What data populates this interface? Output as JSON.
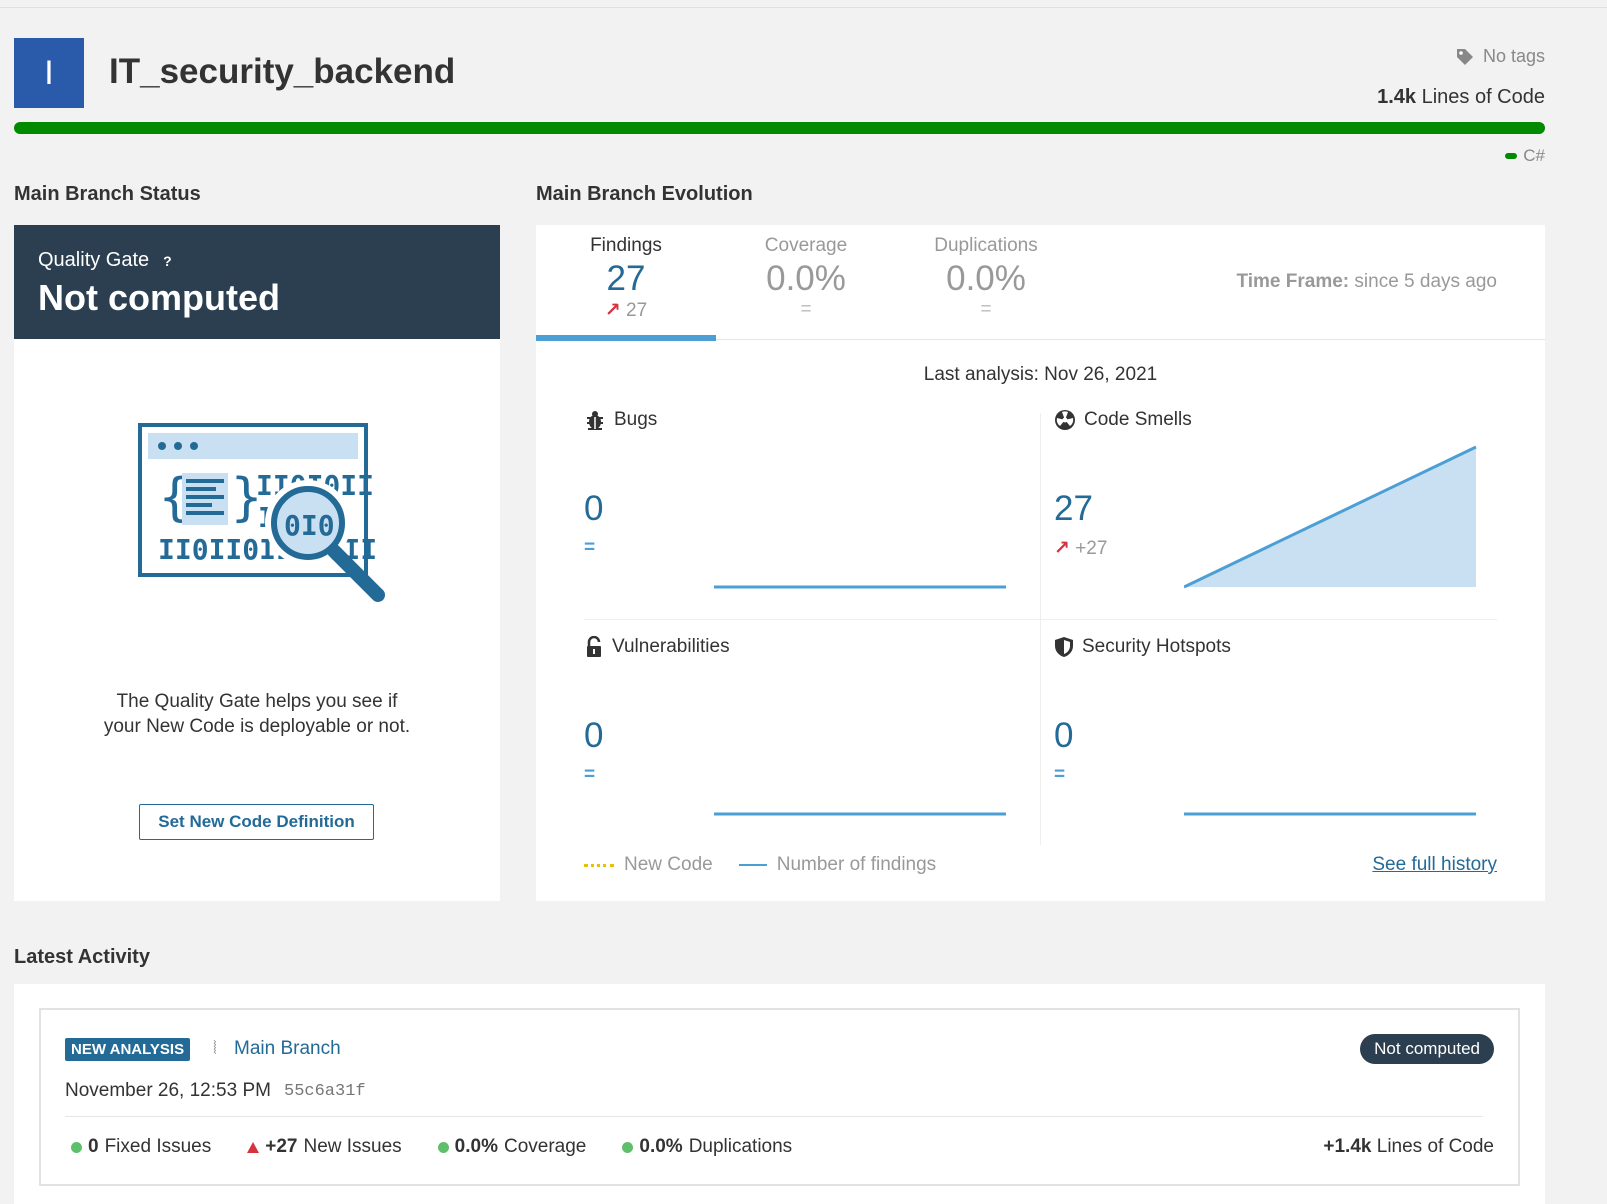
{
  "project": {
    "avatar_letter": "I",
    "name": "IT_security_backend",
    "tags": "No tags",
    "loc_value": "1.4k",
    "loc_label": "Lines of Code",
    "language": "C#",
    "language_color": "#008a00"
  },
  "status": {
    "section_title": "Main Branch Status",
    "qg_label": "Quality Gate",
    "qg_help": "?",
    "qg_status": "Not computed",
    "help_text_1": "The Quality Gate helps you see if",
    "help_text_2": "your New Code is deployable or not.",
    "button_label": "Set New Code Definition"
  },
  "evolution": {
    "section_title": "Main Branch Evolution",
    "tabs": [
      {
        "label": "Findings",
        "value": "27",
        "delta": "27",
        "trend": "up",
        "active": true
      },
      {
        "label": "Coverage",
        "value": "0.0%",
        "delta": "=",
        "active": false
      },
      {
        "label": "Duplications",
        "value": "0.0%",
        "delta": "=",
        "active": false
      }
    ],
    "timeframe_label": "Time Frame:",
    "timeframe_value": "since 5 days ago",
    "last_analysis": "Last analysis: Nov 26, 2021",
    "metrics": {
      "bugs": {
        "label": "Bugs",
        "value": "0",
        "delta": "="
      },
      "code_smells": {
        "label": "Code Smells",
        "value": "27",
        "delta": "+27"
      },
      "vulnerabilities": {
        "label": "Vulnerabilities",
        "value": "0",
        "delta": "="
      },
      "hotspots": {
        "label": "Security Hotspots",
        "value": "0",
        "delta": "="
      }
    },
    "legend_new_code": "New Code",
    "legend_findings": "Number of findings",
    "full_history": "See full history"
  },
  "activity": {
    "section_title": "Latest Activity",
    "badge": "NEW ANALYSIS",
    "branch": "Main Branch",
    "status": "Not computed",
    "date": "November 26, 12:53 PM",
    "hash": "55c6a31f",
    "fixed_value": "0",
    "fixed_label": "Fixed Issues",
    "new_value": "+27",
    "new_label": "New Issues",
    "coverage_value": "0.0%",
    "coverage_label": "Coverage",
    "dup_value": "0.0%",
    "dup_label": "Duplications",
    "loc_value": "+1.4k",
    "loc_label": "Lines of Code"
  },
  "colors": {
    "primary": "#236a97",
    "accent_blue": "#4b9fd5",
    "dark_header": "#2b3f50",
    "success": "#008a00",
    "error": "#d4333f"
  }
}
